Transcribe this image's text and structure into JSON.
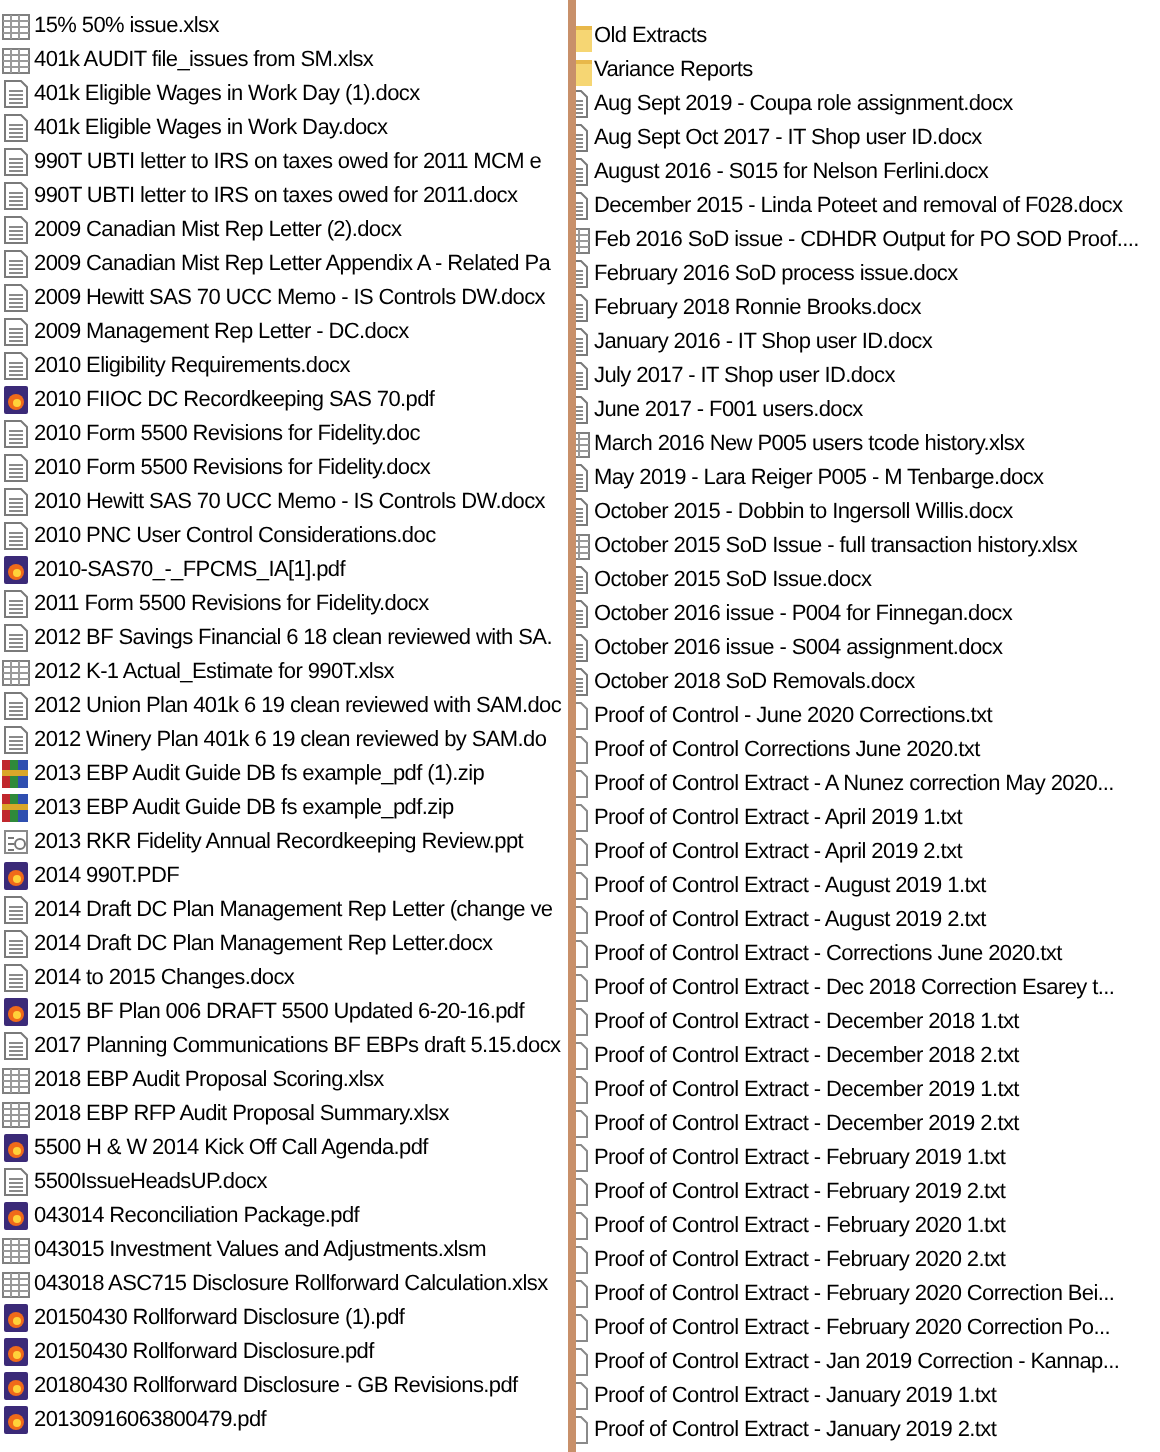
{
  "left_pane": {
    "files": [
      {
        "name": "15% 50% issue.xlsx",
        "kind": "sheet"
      },
      {
        "name": "401k AUDIT file_issues from SM.xlsx",
        "kind": "sheet"
      },
      {
        "name": "401k Eligible Wages in Work Day (1).docx",
        "kind": "doc"
      },
      {
        "name": "401k Eligible Wages in Work Day.docx",
        "kind": "doc"
      },
      {
        "name": "990T UBTI letter to IRS on taxes owed for 2011 MCM e",
        "kind": "doc"
      },
      {
        "name": "990T UBTI letter to IRS on taxes owed for 2011.docx",
        "kind": "doc"
      },
      {
        "name": "2009 Canadian Mist Rep Letter (2).docx",
        "kind": "doc"
      },
      {
        "name": "2009 Canadian Mist Rep Letter Appendix A - Related Pa",
        "kind": "doc"
      },
      {
        "name": "2009 Hewitt SAS 70 UCC Memo - IS Controls DW.docx",
        "kind": "doc"
      },
      {
        "name": "2009 Management Rep Letter - DC.docx",
        "kind": "doc"
      },
      {
        "name": "2010 Eligibility Requirements.docx",
        "kind": "doc"
      },
      {
        "name": "2010 FIIOC DC Recordkeeping SAS 70.pdf",
        "kind": "pdf"
      },
      {
        "name": "2010 Form 5500 Revisions for Fidelity.doc",
        "kind": "doc"
      },
      {
        "name": "2010 Form 5500 Revisions for Fidelity.docx",
        "kind": "doc"
      },
      {
        "name": "2010 Hewitt SAS 70 UCC Memo - IS Controls DW.docx",
        "kind": "doc"
      },
      {
        "name": "2010 PNC User Control Considerations.doc",
        "kind": "doc"
      },
      {
        "name": "2010-SAS70_-_FPCMS_IA[1].pdf",
        "kind": "pdf"
      },
      {
        "name": "2011 Form 5500 Revisions for Fidelity.docx",
        "kind": "doc"
      },
      {
        "name": "2012 BF Savings Financial  6 18 clean reviewed with SA.",
        "kind": "doc"
      },
      {
        "name": "2012 K-1 Actual_Estimate for 990T.xlsx",
        "kind": "sheet"
      },
      {
        "name": "2012 Union Plan 401k 6 19 clean reviewed with SAM.doc",
        "kind": "doc"
      },
      {
        "name": "2012 Winery Plan 401k  6 19 clean reviewed by SAM.do",
        "kind": "doc"
      },
      {
        "name": "2013 EBP Audit Guide DB fs example_pdf (1).zip",
        "kind": "zip"
      },
      {
        "name": "2013 EBP Audit Guide DB fs example_pdf.zip",
        "kind": "zip"
      },
      {
        "name": "2013 RKR  Fidelity Annual Recordkeeping Review.ppt",
        "kind": "slides"
      },
      {
        "name": "2014 990T.PDF",
        "kind": "pdf"
      },
      {
        "name": "2014 Draft DC Plan Management Rep Letter (change ve",
        "kind": "doc"
      },
      {
        "name": "2014 Draft DC Plan Management Rep Letter.docx",
        "kind": "doc"
      },
      {
        "name": "2014 to 2015 Changes.docx",
        "kind": "doc"
      },
      {
        "name": "2015 BF Plan 006 DRAFT 5500 Updated 6-20-16.pdf",
        "kind": "pdf"
      },
      {
        "name": "2017 Planning Communications BF EBPs draft 5.15.docx",
        "kind": "doc"
      },
      {
        "name": "2018 EBP Audit Proposal Scoring.xlsx",
        "kind": "sheet"
      },
      {
        "name": "2018 EBP RFP Audit Proposal Summary.xlsx",
        "kind": "sheet"
      },
      {
        "name": "5500 H & W 2014 Kick Off Call Agenda.pdf",
        "kind": "pdf"
      },
      {
        "name": "5500IssueHeadsUP.docx",
        "kind": "doc"
      },
      {
        "name": "043014 Reconciliation Package.pdf",
        "kind": "pdf"
      },
      {
        "name": "043015 Investment Values and Adjustments.xlsm",
        "kind": "sheet"
      },
      {
        "name": "043018 ASC715 Disclosure Rollforward Calculation.xlsx",
        "kind": "sheet"
      },
      {
        "name": "20150430 Rollforward Disclosure (1).pdf",
        "kind": "pdf"
      },
      {
        "name": "20150430 Rollforward Disclosure.pdf",
        "kind": "pdf"
      },
      {
        "name": "20180430 Rollforward Disclosure - GB Revisions.pdf",
        "kind": "pdf"
      },
      {
        "name": "20130916063800479.pdf",
        "kind": "pdf"
      }
    ]
  },
  "right_pane": {
    "files": [
      {
        "name": "Old Extracts",
        "kind": "folder"
      },
      {
        "name": "Variance Reports",
        "kind": "folder"
      },
      {
        "name": "Aug Sept 2019 - Coupa role assignment.docx",
        "kind": "doc"
      },
      {
        "name": "Aug Sept Oct 2017 - IT Shop user ID.docx",
        "kind": "doc"
      },
      {
        "name": "August 2016 - S015 for Nelson Ferlini.docx",
        "kind": "doc"
      },
      {
        "name": "December 2015 - Linda Poteet and removal of F028.docx",
        "kind": "doc"
      },
      {
        "name": "Feb 2016 SoD issue - CDHDR Output for PO SOD Proof....",
        "kind": "sheet"
      },
      {
        "name": "February 2016 SoD process issue.docx",
        "kind": "doc"
      },
      {
        "name": "February 2018 Ronnie Brooks.docx",
        "kind": "doc"
      },
      {
        "name": "January 2016 - IT Shop user ID.docx",
        "kind": "doc"
      },
      {
        "name": "July 2017 - IT Shop user ID.docx",
        "kind": "doc"
      },
      {
        "name": "June 2017 - F001 users.docx",
        "kind": "doc"
      },
      {
        "name": "March 2016 New P005 users tcode history.xlsx",
        "kind": "sheet"
      },
      {
        "name": "May 2019 - Lara Reiger P005 - M Tenbarge.docx",
        "kind": "doc"
      },
      {
        "name": "October 2015 - Dobbin to Ingersoll Willis.docx",
        "kind": "doc"
      },
      {
        "name": "October 2015 SoD Issue - full transaction history.xlsx",
        "kind": "sheet"
      },
      {
        "name": "October 2015 SoD Issue.docx",
        "kind": "doc"
      },
      {
        "name": "October 2016 issue - P004 for Finnegan.docx",
        "kind": "doc"
      },
      {
        "name": "October 2016 issue - S004 assignment.docx",
        "kind": "doc"
      },
      {
        "name": "October 2018 SoD Removals.docx",
        "kind": "doc"
      },
      {
        "name": "Proof of Control - June 2020 Corrections.txt",
        "kind": "text"
      },
      {
        "name": "Proof of Control Corrections June 2020.txt",
        "kind": "text"
      },
      {
        "name": "Proof of Control Extract - A Nunez correction May 2020...",
        "kind": "text"
      },
      {
        "name": "Proof of Control Extract - April 2019 1.txt",
        "kind": "text"
      },
      {
        "name": "Proof of Control Extract - April 2019 2.txt",
        "kind": "text"
      },
      {
        "name": "Proof of Control Extract - August 2019 1.txt",
        "kind": "text"
      },
      {
        "name": "Proof of Control Extract - August 2019 2.txt",
        "kind": "text"
      },
      {
        "name": "Proof of Control Extract - Corrections June 2020.txt",
        "kind": "text"
      },
      {
        "name": "Proof of Control Extract - Dec 2018 Correction Esarey t...",
        "kind": "text"
      },
      {
        "name": "Proof of Control Extract - December 2018 1.txt",
        "kind": "text"
      },
      {
        "name": "Proof of Control Extract - December 2018 2.txt",
        "kind": "text"
      },
      {
        "name": "Proof of Control Extract - December 2019 1.txt",
        "kind": "text"
      },
      {
        "name": "Proof of Control Extract - December 2019 2.txt",
        "kind": "text"
      },
      {
        "name": "Proof of Control Extract - February 2019 1.txt",
        "kind": "text"
      },
      {
        "name": "Proof of Control Extract - February 2019 2.txt",
        "kind": "text"
      },
      {
        "name": "Proof of Control Extract - February 2020 1.txt",
        "kind": "text"
      },
      {
        "name": "Proof of Control Extract - February 2020 2.txt",
        "kind": "text"
      },
      {
        "name": "Proof of Control Extract - February 2020 Correction Bei...",
        "kind": "text"
      },
      {
        "name": "Proof of Control Extract - February 2020 Correction Po...",
        "kind": "text"
      },
      {
        "name": "Proof of Control Extract - Jan 2019 Correction - Kannap...",
        "kind": "text"
      },
      {
        "name": "Proof of Control Extract - January 2019 1.txt",
        "kind": "text"
      },
      {
        "name": "Proof of Control Extract - January 2019 2.txt",
        "kind": "text"
      }
    ]
  }
}
